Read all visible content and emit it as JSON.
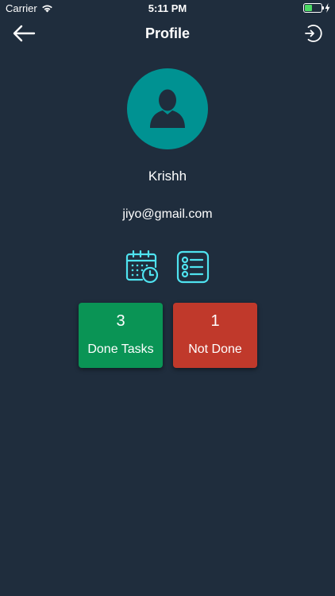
{
  "status_bar": {
    "carrier": "Carrier",
    "time": "5:11 PM",
    "battery_level": 0.45
  },
  "nav": {
    "title": "Profile",
    "back_icon": "arrow-left-icon",
    "logout_icon": "logout-icon"
  },
  "profile": {
    "name": "Krishh",
    "email": "jiyo@gmail.com",
    "avatar_icon": "person-silhouette-icon",
    "avatar_color": "#009292"
  },
  "actions": {
    "calendar_icon": "calendar-clock-icon",
    "list_icon": "checklist-icon",
    "icon_color": "#4fe3f0"
  },
  "stats": {
    "done": {
      "count": "3",
      "label": "Done Tasks",
      "color": "#0a9455"
    },
    "not_done": {
      "count": "1",
      "label": "Not Done",
      "color": "#c0392b"
    }
  },
  "colors": {
    "background": "#1f2d3d"
  }
}
